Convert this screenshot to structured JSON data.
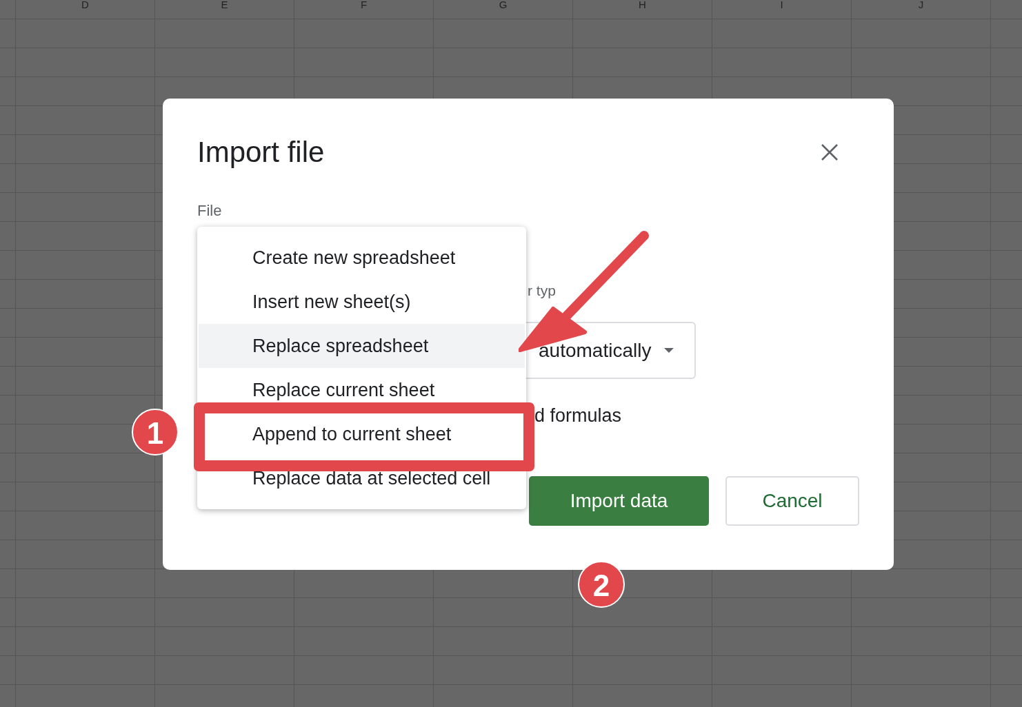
{
  "sheet": {
    "columns": [
      "D",
      "E",
      "F",
      "G",
      "H",
      "I",
      "J"
    ]
  },
  "dialog": {
    "title": "Import file",
    "file_label": "File",
    "menu": {
      "items": [
        {
          "label": "Create new spreadsheet",
          "selected": false
        },
        {
          "label": "Insert new sheet(s)",
          "selected": false
        },
        {
          "label": "Replace spreadsheet",
          "selected": true
        },
        {
          "label": "Replace current sheet",
          "selected": false
        },
        {
          "label": "Append to current sheet",
          "selected": false
        },
        {
          "label": "Replace data at selected cell",
          "selected": false
        }
      ]
    },
    "separator_label": "r typ",
    "separator_value": "automatically",
    "formulas_label": "d formulas",
    "buttons": [
      {
        "label": "Import data",
        "kind": "primary"
      },
      {
        "label": "Cancel",
        "kind": "secondary"
      }
    ]
  },
  "annotations": {
    "badges": [
      "1",
      "2"
    ]
  }
}
